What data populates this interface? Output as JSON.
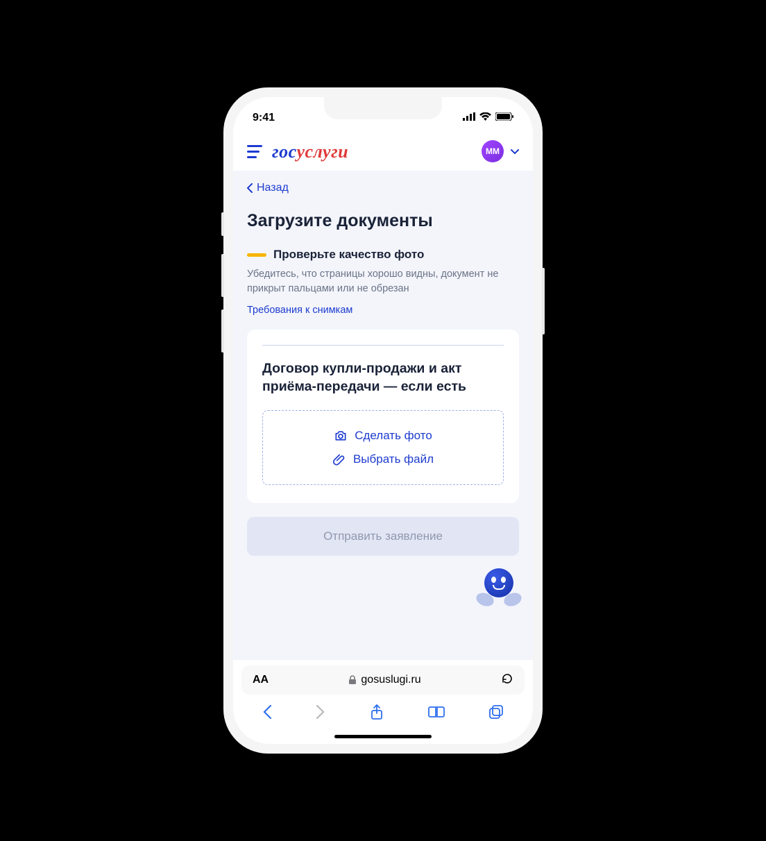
{
  "status": {
    "time": "9:41"
  },
  "header": {
    "logo_part1": "гос",
    "logo_part2": "услуги",
    "avatar_initials": "ММ"
  },
  "nav": {
    "back_label": "Назад"
  },
  "page": {
    "title": "Загрузите документы",
    "warning_title": "Проверьте качество фото",
    "warning_text": "Убедитесь, что страницы хорошо видны, документ не прикрыт пальцами или не обрезан",
    "requirements_link": "Требования к снимкам"
  },
  "upload_card": {
    "title": "Договор купли-продажи и акт приёма-передачи — если есть",
    "take_photo": "Сделать фото",
    "choose_file": "Выбрать файл"
  },
  "submit": {
    "label": "Отправить заявление"
  },
  "browser": {
    "text_size": "AA",
    "domain": "gosuslugi.ru"
  }
}
